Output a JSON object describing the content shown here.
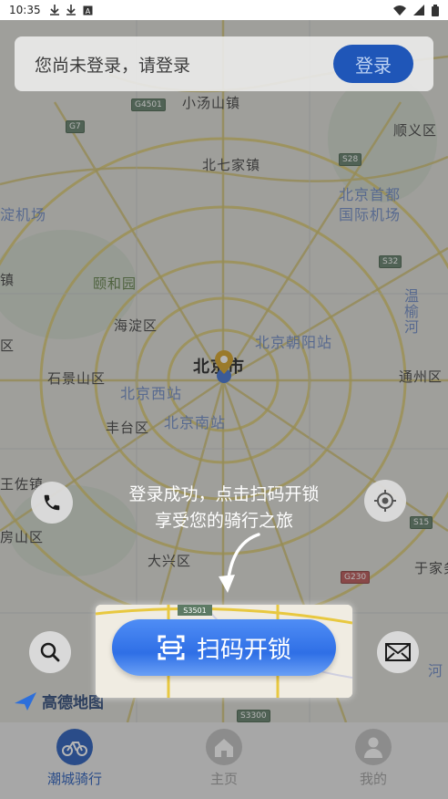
{
  "status_bar": {
    "time": "10:35",
    "icons": [
      "download-icon",
      "download-icon",
      "a-icon"
    ],
    "right_icons": [
      "wifi-icon",
      "signal-icon",
      "battery-icon"
    ]
  },
  "login": {
    "prompt": "您尚未登录，请登录",
    "button_label": "登录"
  },
  "map": {
    "labels": {
      "xiaotangshan": "小汤山镇",
      "shunyi": "顺义区",
      "beiqijia": "北七家镇",
      "airport1": "北京首都",
      "airport2": "国际机场",
      "jichang": "淀机场",
      "zhen": "镇",
      "yiheyuan": "颐和园",
      "haidian": "海淀区",
      "wenyu": "温榆河",
      "qu": "区",
      "chaoyang": "北京朝阳站",
      "beijing": "北京市",
      "shijingshan": "石景山区",
      "xizhan": "北京西站",
      "tongzhou": "通州区",
      "fengtai": "丰台区",
      "nanzhan": "北京南站",
      "wangzuo": "王佐镇",
      "fangshan": "房山区",
      "daxing": "大兴区",
      "yujiawu": "于家务",
      "he": "河"
    },
    "shields": {
      "g4501": "G4501",
      "g7": "G7",
      "s28": "S28",
      "s32": "S32",
      "s15": "S15",
      "g230": "G230",
      "s3501": "S3501",
      "s3300": "S3300"
    }
  },
  "logo_text": "高德地图",
  "tooltip": {
    "line1": "登录成功，点击扫码开锁",
    "line2": "享受您的骑行之旅"
  },
  "scan_button": {
    "label": "扫码开锁"
  },
  "bottom_nav": {
    "items": [
      {
        "label": "潮城骑行",
        "icon": "bike-icon",
        "active": true
      },
      {
        "label": "主页",
        "icon": "home-icon",
        "active": false
      },
      {
        "label": "我的",
        "icon": "user-icon",
        "active": false
      }
    ]
  },
  "colors": {
    "accent": "#1f56b8",
    "scan_button": "#3b7cf0"
  }
}
